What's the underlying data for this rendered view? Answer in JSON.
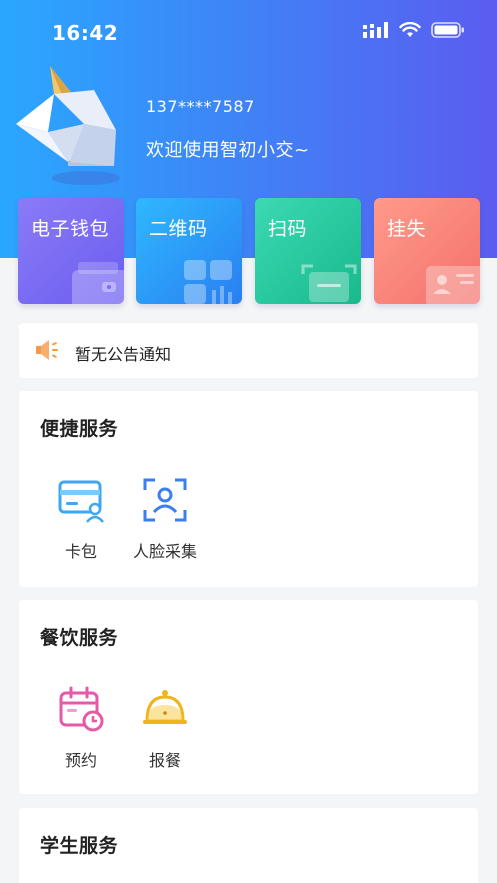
{
  "status_bar": {
    "time": "16:42"
  },
  "user": {
    "phone": "137****7587",
    "welcome": "欢迎使用智初小交~"
  },
  "tiles": [
    {
      "label": "电子钱包",
      "icon": "wallet-icon"
    },
    {
      "label": "二维码",
      "icon": "qr-code-icon"
    },
    {
      "label": "扫码",
      "icon": "scan-icon"
    },
    {
      "label": "挂失",
      "icon": "id-card-icon"
    }
  ],
  "notice": {
    "text": "暂无公告通知",
    "icon": "speaker-icon"
  },
  "sections": {
    "convenience": {
      "title": "便捷服务",
      "items": [
        {
          "label": "卡包",
          "icon": "card-wallet-icon"
        },
        {
          "label": "人脸采集",
          "icon": "face-scan-icon"
        }
      ]
    },
    "dining": {
      "title": "餐饮服务",
      "items": [
        {
          "label": "预约",
          "icon": "calendar-clock-icon"
        },
        {
          "label": "报餐",
          "icon": "meal-cloche-icon"
        }
      ]
    },
    "student": {
      "title": "学生服务"
    }
  },
  "colors": {
    "header_start": "#2aa7ff",
    "header_end": "#5b5cf0",
    "tile_wallet": "#7a6cf4",
    "tile_qr": "#2a9cf8",
    "tile_scan": "#22c79f",
    "tile_report_loss": "#f7847a"
  }
}
